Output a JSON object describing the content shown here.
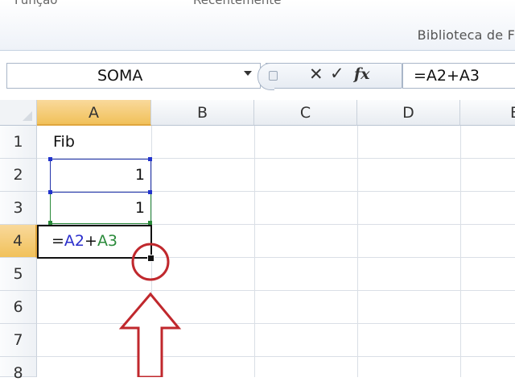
{
  "ribbon": {
    "cut_label_left": "Função",
    "cut_label_right": "Recentemente",
    "group_label": "Biblioteca de F"
  },
  "formula_bar": {
    "name_box": "SOMA",
    "cancel_icon": "✕",
    "enter_icon": "✓",
    "fx_icon": "fx",
    "formula": "=A2+A3"
  },
  "columns": [
    "A",
    "B",
    "C",
    "D",
    "E"
  ],
  "rows": [
    "1",
    "2",
    "3",
    "4",
    "5",
    "6",
    "7",
    "8"
  ],
  "cells": {
    "A1": "Fib",
    "A2": "1",
    "A3": "1",
    "A4": {
      "eq": "=",
      "a2": "A2",
      "plus": "+",
      "a3": "A3"
    }
  },
  "colors": {
    "ref_blue": "#2233aa",
    "ref_green": "#2a8a3a",
    "annotation_red": "#c0282d",
    "selected_header": "#f1c15a"
  },
  "annotation": {
    "circle_icon": "circle-marker-icon",
    "arrow_icon": "up-arrow-icon"
  }
}
